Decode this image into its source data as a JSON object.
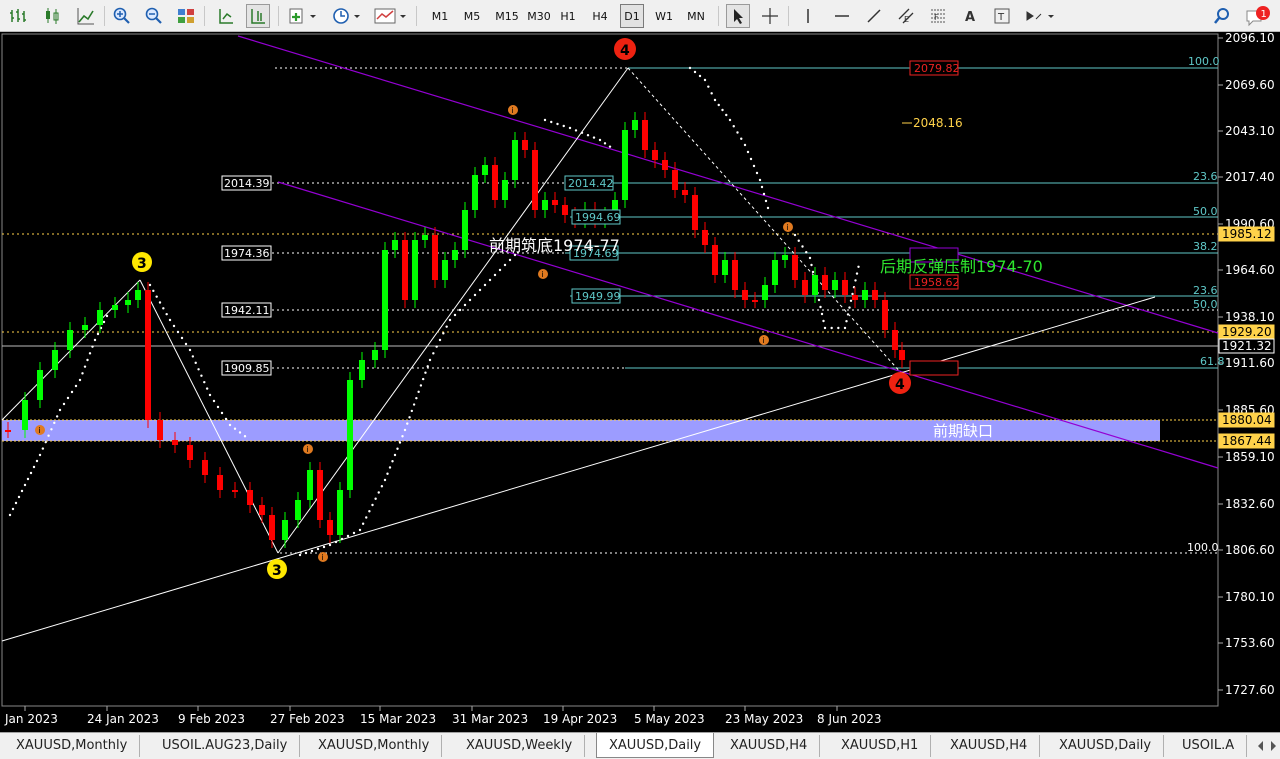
{
  "toolbar": {
    "timeframes": [
      "M1",
      "M5",
      "M15",
      "M30",
      "H1",
      "H4",
      "D1",
      "W1",
      "MN"
    ],
    "active_timeframe": "D1",
    "notification_count": "1"
  },
  "colors": {
    "bull": "#00ff00",
    "bear": "#ff0000",
    "channel": "#9400d3",
    "gap_band": "#9c9cff",
    "fib": "#5fc8c8",
    "label_green": "#2ee62e"
  },
  "chart": {
    "y_ticks": [
      "2096.10",
      "2069.60",
      "2043.10",
      "2017.40",
      "1990.60",
      "1964.60",
      "1938.10",
      "1911.60",
      "1885.60",
      "1859.10",
      "1832.60",
      "1806.60",
      "1780.10",
      "1753.60",
      "1727.60"
    ],
    "x_ticks": [
      "Jan 2023",
      "24 Jan 2023",
      "9 Feb 2023",
      "27 Feb 2023",
      "15 Mar 2023",
      "31 Mar 2023",
      "19 Apr 2023",
      "5 May 2023",
      "23 May 2023",
      "8 Jun 2023"
    ],
    "price_tags": [
      "2048.16",
      "1985.12",
      "1929.20",
      "1921.32",
      "1880.04",
      "1867.44"
    ],
    "level_labels": [
      "2014.39",
      "1974.36",
      "1942.11",
      "1909.85"
    ],
    "fib_labels": [
      "2014.42",
      "1994.69",
      "1974.69",
      "1949.99"
    ],
    "red_box_labels": [
      "2079.82",
      "1958.62"
    ],
    "fib_pct": [
      "100.0",
      "23.6",
      "50.0",
      "38.2",
      "23.6",
      "50.0",
      "61.8",
      "100.0"
    ],
    "wave_labels": [
      "3",
      "3",
      "4",
      "4"
    ],
    "small_markers": [
      "i",
      "i",
      "i",
      "i",
      "i",
      "i",
      "i"
    ],
    "annotations": {
      "support": "前期筑底1974-77",
      "resistance": "后期反弹压制1974-70",
      "gap": "前期缺口"
    }
  },
  "tabs": [
    "XAUUSD,Monthly",
    "USOIL.AUG23,Daily",
    "XAUUSD,Monthly",
    "XAUUSD,Weekly",
    "XAUUSD,Daily",
    "XAUUSD,H4",
    "XAUUSD,H1",
    "XAUUSD,H4",
    "XAUUSD,Daily",
    "USOIL.A"
  ],
  "active_tab": "XAUUSD,Daily"
}
